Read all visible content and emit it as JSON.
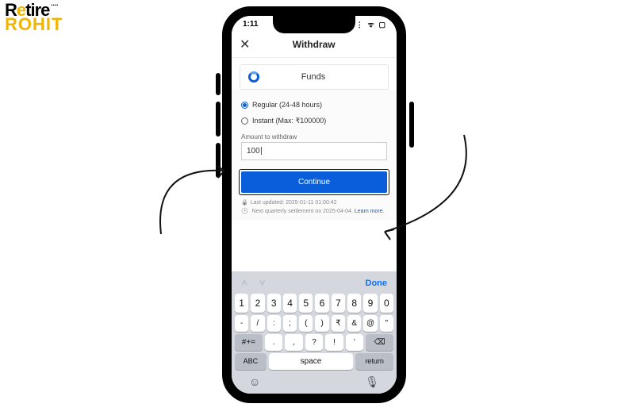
{
  "brand": {
    "line1_pre": "R",
    "line1_e": "e",
    "line1_post": "tire",
    "line2": "ROHIT"
  },
  "status": {
    "time": "1:11",
    "signal": "▪▪▪",
    "wifi": "📶",
    "battery": "🔋"
  },
  "nav": {
    "close": "✕",
    "title": "Withdraw"
  },
  "funds": {
    "label": "Funds"
  },
  "options": {
    "regular": "Regular (24-48 hours)",
    "instant": "Instant (Max: ₹100000)"
  },
  "amount": {
    "label": "Amount to withdraw",
    "value": "100"
  },
  "continue_label": "Continue",
  "meta": {
    "updated": "Last updated: 2025-01-11 01:00:42",
    "settlement_pre": "Next quarterly settlement on 2025-04-04. ",
    "learn_more": "Learn more."
  },
  "keyboard": {
    "done": "Done",
    "row1": [
      "1",
      "2",
      "3",
      "4",
      "5",
      "6",
      "7",
      "8",
      "9",
      "0"
    ],
    "row2": [
      "-",
      "/",
      ":",
      ";",
      "(",
      ")",
      "₹",
      "&",
      "@",
      "\""
    ],
    "numswitch": "#+=",
    "row3": [
      ".",
      ",",
      "?",
      "!",
      "'"
    ],
    "backspace": "⌫",
    "abc": "ABC",
    "space": "space",
    "return": "return",
    "emoji": "😊",
    "mic": "🎤"
  }
}
